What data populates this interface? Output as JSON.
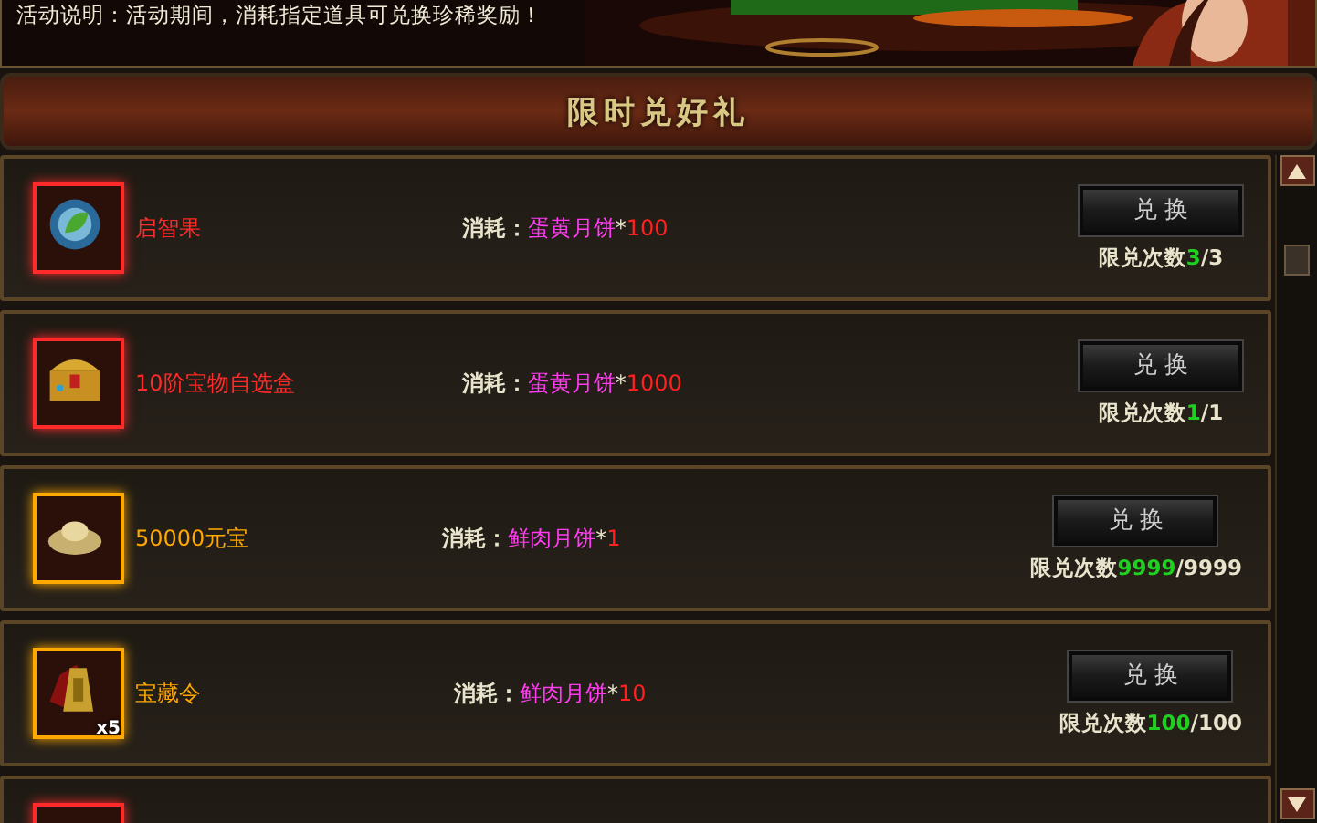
{
  "banner": {
    "text": "活动说明：活动期间，消耗指定道具可兑换珍稀奖励！"
  },
  "title": "限时兑好礼",
  "items": [
    {
      "name": "启智果",
      "color": "#ff2a2a",
      "cost": {
        "label": "消耗：",
        "item": "蛋黄月饼",
        "multiplier": "*",
        "amount": "100"
      },
      "button": "兑 换",
      "limit": {
        "label": "限兑次数",
        "used": "3",
        "total": "/3"
      }
    },
    {
      "name": "10阶宝物自选盒",
      "color": "#ff2a2a",
      "cost": {
        "label": "消耗：",
        "item": "蛋黄月饼",
        "multiplier": "*",
        "amount": "1000"
      },
      "button": "兑 换",
      "limit": {
        "label": "限兑次数",
        "used": "1",
        "total": "/1"
      }
    },
    {
      "name": "50000元宝",
      "color": "#ffa800",
      "cost": {
        "label": "消耗：",
        "item": "鲜肉月饼",
        "multiplier": "*",
        "amount": "1"
      },
      "button": "兑 换",
      "limit": {
        "label": "限兑次数",
        "used": "9999",
        "total": "/9999"
      }
    },
    {
      "name": "宝藏令",
      "color": "#ffa800",
      "badge": "x5",
      "cost": {
        "label": "消耗：",
        "item": "鲜肉月饼",
        "multiplier": "*",
        "amount": "10"
      },
      "button": "兑 换",
      "limit": {
        "label": "限兑次数",
        "used": "100",
        "total": "/100"
      }
    },
    {
      "color": "#ff2a2a"
    }
  ]
}
